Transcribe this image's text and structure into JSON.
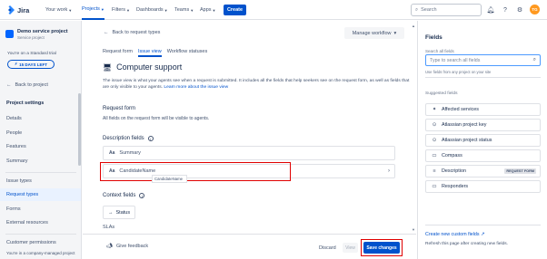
{
  "header": {
    "logo_text": "Jira",
    "nav": [
      {
        "label": "Your work"
      },
      {
        "label": "Projects"
      },
      {
        "label": "Filters"
      },
      {
        "label": "Dashboards"
      },
      {
        "label": "Teams"
      },
      {
        "label": "Apps"
      }
    ],
    "create_label": "Create",
    "search_placeholder": "Search",
    "avatar_initials": "TG",
    "accent_color": "#0052cc"
  },
  "sidebar": {
    "project_name": "Demo service project",
    "project_type": "Service project",
    "trial_text": "You're on a Standard trial",
    "trial_badge": "15 DAYS LEFT",
    "back_label": "Back to project",
    "settings_heading": "Project settings",
    "items_group1": [
      "Details",
      "People",
      "Features",
      "Summary"
    ],
    "items_group2": [
      "Issue types",
      "Request types",
      "Forms",
      "External resources"
    ],
    "items_group3": [
      "Customer permissions",
      "You're in a company-managed project"
    ]
  },
  "main": {
    "back_label": "Back to request types",
    "manage_workflow": "Manage workflow",
    "tabs": [
      "Request form",
      "Issue view",
      "Workflow statuses"
    ],
    "title": "Computer support",
    "description": "The issue view is what your agents see when a request is submitted. It includes all the fields that help seekers see on the request form, as well as fields that are only visible to your agents.",
    "learn_more": "Learn more about the issue view",
    "request_form_heading": "Request form",
    "request_form_sub": "All fields on the request form will be visible to agents.",
    "description_fields_heading": "Description fields",
    "description_fields": [
      {
        "icon": "Aa",
        "label": "Summary"
      },
      {
        "icon": "Aa",
        "label": "CandidateName"
      }
    ],
    "tooltip_text": "CandidateName",
    "context_fields_heading": "Context fields",
    "status_label": "Status",
    "slas_label": "SLAs"
  },
  "footer": {
    "feedback": "Give feedback",
    "discard": "Discard",
    "view": "View",
    "save": "Save changes"
  },
  "fields_panel": {
    "title": "Fields",
    "search_label": "Search all fields",
    "search_placeholder": "Type to search all fields",
    "hint": "Use fields from any project on your site",
    "suggested_heading": "Suggested fields",
    "items": [
      {
        "icon": "puzzle-icon",
        "label": "Affected services",
        "badge": ""
      },
      {
        "icon": "key-icon",
        "label": "Atlassian project key",
        "badge": ""
      },
      {
        "icon": "status-icon",
        "label": "Atlassian project status",
        "badge": ""
      },
      {
        "icon": "folder-icon",
        "label": "Compass",
        "badge": ""
      },
      {
        "icon": "description-icon",
        "label": "Description",
        "badge": "REQUEST FORM"
      },
      {
        "icon": "people-icon",
        "label": "Responders",
        "badge": ""
      }
    ],
    "create_link": "Create new custom fields",
    "refresh_text": "Refresh this page after creating new fields."
  }
}
